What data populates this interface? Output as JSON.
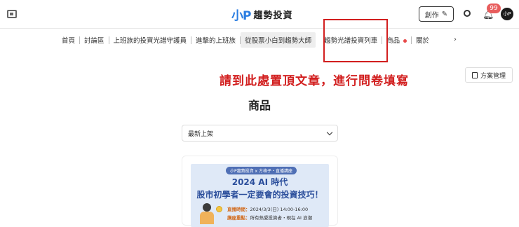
{
  "header": {
    "logo_mark": "小P",
    "logo_text": "趨勢投資",
    "create_label": "創作",
    "notification_count": "99",
    "avatar_text": "小P"
  },
  "nav": {
    "items": [
      {
        "label": "首頁"
      },
      {
        "label": "討論區"
      },
      {
        "label": "上班族的投資光譜守護員"
      },
      {
        "label": "進擊的上班族"
      },
      {
        "label": "從股票小白到趨勢大師"
      },
      {
        "label": "趨勢光譜投資列車"
      },
      {
        "label": "商品"
      },
      {
        "label": "關於"
      }
    ],
    "more_arrow": "›"
  },
  "annotation": {
    "text": "請到此處置頂文章，進行問卷填寫",
    "color": "#d21f1f"
  },
  "plan_button": {
    "label": "方案管理"
  },
  "section": {
    "title": "商品"
  },
  "sort_select": {
    "value": "最新上架"
  },
  "product": {
    "banner_tag": "小P趨勢投資 x 方格子・直播講座",
    "title_line1": "2024 AI 時代",
    "title_line2": "股市初學者一定要會的投資技巧！",
    "info_label1": "直播時間：",
    "info_value1": "2024/3/3(日) 14:00-16:00",
    "info_label2": "講座重點：",
    "info_value2": "所有熱愛投資者・現在 AI 浪潮"
  },
  "colors": {
    "accent": "#2a7de1",
    "badge": "#e85d5d",
    "highlight_border": "#d21f1f"
  }
}
